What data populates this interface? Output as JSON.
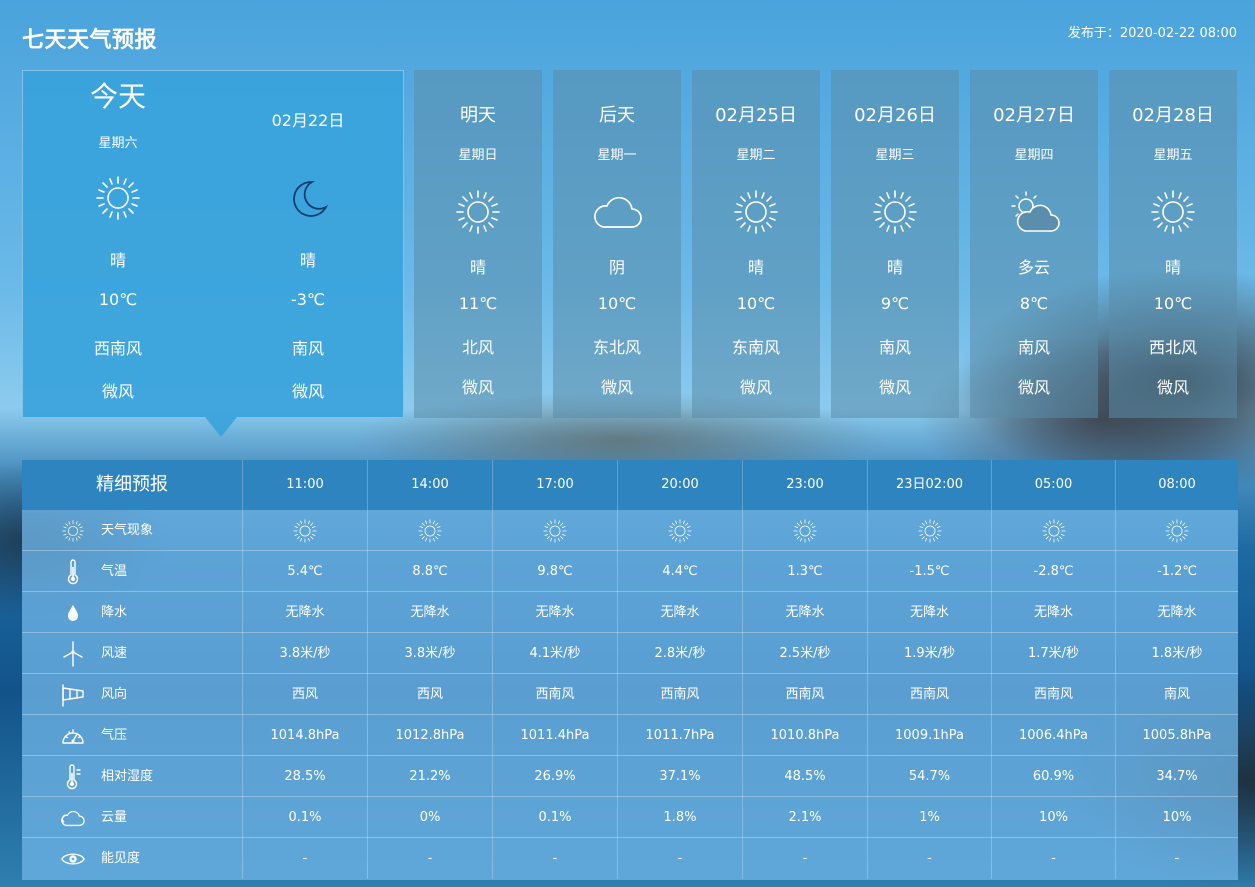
{
  "header": {
    "title": "七天天气预报",
    "publish": "发布于：2020-02-22 08:00"
  },
  "today": {
    "label": "今天",
    "weekday": "星期六",
    "date": "02月22日",
    "day": {
      "icon": "sun-icon",
      "weather": "晴",
      "temp": "10℃",
      "wind_dir": "西南风",
      "wind_level": "微风"
    },
    "night": {
      "icon": "moon-icon",
      "weather": "晴",
      "temp": "-3℃",
      "wind_dir": "南风",
      "wind_level": "微风"
    }
  },
  "days": [
    {
      "label": "明天",
      "weekday": "星期日",
      "icon": "sun-icon",
      "weather": "晴",
      "temp": "11℃",
      "wind_dir": "北风",
      "wind_level": "微风"
    },
    {
      "label": "后天",
      "weekday": "星期一",
      "icon": "cloud-icon",
      "weather": "阴",
      "temp": "10℃",
      "wind_dir": "东北风",
      "wind_level": "微风"
    },
    {
      "label": "02月25日",
      "weekday": "星期二",
      "icon": "sun-icon",
      "weather": "晴",
      "temp": "10℃",
      "wind_dir": "东南风",
      "wind_level": "微风"
    },
    {
      "label": "02月26日",
      "weekday": "星期三",
      "icon": "sun-icon",
      "weather": "晴",
      "temp": "9℃",
      "wind_dir": "南风",
      "wind_level": "微风"
    },
    {
      "label": "02月27日",
      "weekday": "星期四",
      "icon": "partly-cloudy-icon",
      "weather": "多云",
      "temp": "8℃",
      "wind_dir": "南风",
      "wind_level": "微风"
    },
    {
      "label": "02月28日",
      "weekday": "星期五",
      "icon": "sun-icon",
      "weather": "晴",
      "temp": "10℃",
      "wind_dir": "西北风",
      "wind_level": "微风"
    }
  ],
  "detail": {
    "title": "精细预报",
    "times": [
      "11:00",
      "14:00",
      "17:00",
      "20:00",
      "23:00",
      "23日02:00",
      "05:00",
      "08:00"
    ],
    "rows": [
      {
        "icon": "sun-icon",
        "label": "天气现象",
        "values": [
          "",
          "",
          "",
          "",
          "",
          "",
          "",
          ""
        ]
      },
      {
        "icon": "thermometer-icon",
        "label": "气温",
        "values": [
          "5.4℃",
          "8.8℃",
          "9.8℃",
          "4.4℃",
          "1.3℃",
          "-1.5℃",
          "-2.8℃",
          "-1.2℃"
        ]
      },
      {
        "icon": "drop-icon",
        "label": "降水",
        "values": [
          "无降水",
          "无降水",
          "无降水",
          "无降水",
          "无降水",
          "无降水",
          "无降水",
          "无降水"
        ]
      },
      {
        "icon": "wind-turbine-icon",
        "label": "风速",
        "values": [
          "3.8米/秒",
          "3.8米/秒",
          "4.1米/秒",
          "2.8米/秒",
          "2.5米/秒",
          "1.9米/秒",
          "1.7米/秒",
          "1.8米/秒"
        ]
      },
      {
        "icon": "windsock-icon",
        "label": "风向",
        "values": [
          "西风",
          "西风",
          "西南风",
          "西南风",
          "西南风",
          "西南风",
          "西南风",
          "南风"
        ]
      },
      {
        "icon": "gauge-icon",
        "label": "气压",
        "values": [
          "1014.8hPa",
          "1012.8hPa",
          "1011.4hPa",
          "1011.7hPa",
          "1010.8hPa",
          "1009.1hPa",
          "1006.4hPa",
          "1005.8hPa"
        ]
      },
      {
        "icon": "humidity-icon",
        "label": "相对湿度",
        "values": [
          "28.5%",
          "21.2%",
          "26.9%",
          "37.1%",
          "48.5%",
          "54.7%",
          "60.9%",
          "34.7%"
        ]
      },
      {
        "icon": "cloud-icon",
        "label": "云量",
        "values": [
          "0.1%",
          "0%",
          "0.1%",
          "1.8%",
          "2.1%",
          "1%",
          "10%",
          "10%"
        ]
      },
      {
        "icon": "eye-icon",
        "label": "能见度",
        "values": [
          "-",
          "-",
          "-",
          "-",
          "-",
          "-",
          "-",
          "-"
        ]
      }
    ]
  }
}
